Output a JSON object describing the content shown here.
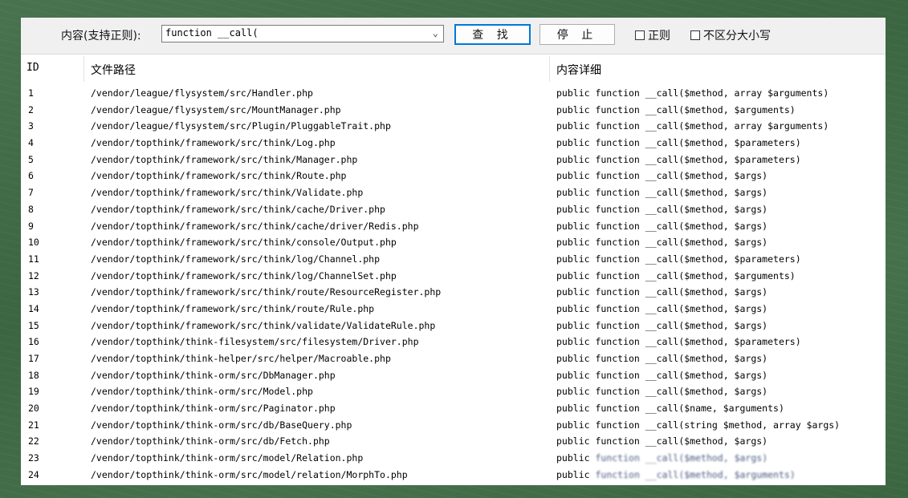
{
  "toolbar": {
    "search_label": "内容(支持正则):",
    "search_value": "function __call(",
    "find_button": "查 找",
    "stop_button": "停 止",
    "regex_label": "正则",
    "case_label": "不区分大小写"
  },
  "columns": {
    "id": "ID",
    "path": "文件路径",
    "detail": "内容详细"
  },
  "rows": [
    {
      "id": "1",
      "path": "/vendor/league/flysystem/src/Handler.php",
      "detail": "public function __call($method, array $arguments)"
    },
    {
      "id": "2",
      "path": "/vendor/league/flysystem/src/MountManager.php",
      "detail": "public function __call($method, $arguments)"
    },
    {
      "id": "3",
      "path": "/vendor/league/flysystem/src/Plugin/PluggableTrait.php",
      "detail": "public function __call($method, array $arguments)"
    },
    {
      "id": "4",
      "path": "/vendor/topthink/framework/src/think/Log.php",
      "detail": "public function __call($method, $parameters)"
    },
    {
      "id": "5",
      "path": "/vendor/topthink/framework/src/think/Manager.php",
      "detail": "public function __call($method, $parameters)"
    },
    {
      "id": "6",
      "path": "/vendor/topthink/framework/src/think/Route.php",
      "detail": "public function __call($method, $args)"
    },
    {
      "id": "7",
      "path": "/vendor/topthink/framework/src/think/Validate.php",
      "detail": "public function __call($method, $args)"
    },
    {
      "id": "8",
      "path": "/vendor/topthink/framework/src/think/cache/Driver.php",
      "detail": "public function __call($method, $args)"
    },
    {
      "id": "9",
      "path": "/vendor/topthink/framework/src/think/cache/driver/Redis.php",
      "detail": "public function __call($method, $args)"
    },
    {
      "id": "10",
      "path": "/vendor/topthink/framework/src/think/console/Output.php",
      "detail": "public function __call($method, $args)"
    },
    {
      "id": "11",
      "path": "/vendor/topthink/framework/src/think/log/Channel.php",
      "detail": "public function __call($method, $parameters)"
    },
    {
      "id": "12",
      "path": "/vendor/topthink/framework/src/think/log/ChannelSet.php",
      "detail": "public function __call($method, $arguments)"
    },
    {
      "id": "13",
      "path": "/vendor/topthink/framework/src/think/route/ResourceRegister.php",
      "detail": "public function __call($method, $args)"
    },
    {
      "id": "14",
      "path": "/vendor/topthink/framework/src/think/route/Rule.php",
      "detail": "public function __call($method, $args)"
    },
    {
      "id": "15",
      "path": "/vendor/topthink/framework/src/think/validate/ValidateRule.php",
      "detail": "public function __call($method, $args)"
    },
    {
      "id": "16",
      "path": "/vendor/topthink/think-filesystem/src/filesystem/Driver.php",
      "detail": "public function __call($method, $parameters)"
    },
    {
      "id": "17",
      "path": "/vendor/topthink/think-helper/src/helper/Macroable.php",
      "detail": "public function __call($method, $args)"
    },
    {
      "id": "18",
      "path": "/vendor/topthink/think-orm/src/DbManager.php",
      "detail": "public function __call($method, $args)"
    },
    {
      "id": "19",
      "path": "/vendor/topthink/think-orm/src/Model.php",
      "detail": "public function __call($method, $args)"
    },
    {
      "id": "20",
      "path": "/vendor/topthink/think-orm/src/Paginator.php",
      "detail": "public function __call($name, $arguments)"
    },
    {
      "id": "21",
      "path": "/vendor/topthink/think-orm/src/db/BaseQuery.php",
      "detail": "public function __call(string $method, array $args)"
    },
    {
      "id": "22",
      "path": "/vendor/topthink/think-orm/src/db/Fetch.php",
      "detail": "public function __call($method, $args)"
    },
    {
      "id": "23",
      "path": "/vendor/topthink/think-orm/src/model/Relation.php",
      "detail": "public",
      "detail_obscured": "function __call($method, $args)"
    },
    {
      "id": "24",
      "path": "/vendor/topthink/think-orm/src/model/relation/MorphTo.php",
      "detail": "public",
      "detail_obscured": "function __call($method, $arguments)"
    }
  ]
}
